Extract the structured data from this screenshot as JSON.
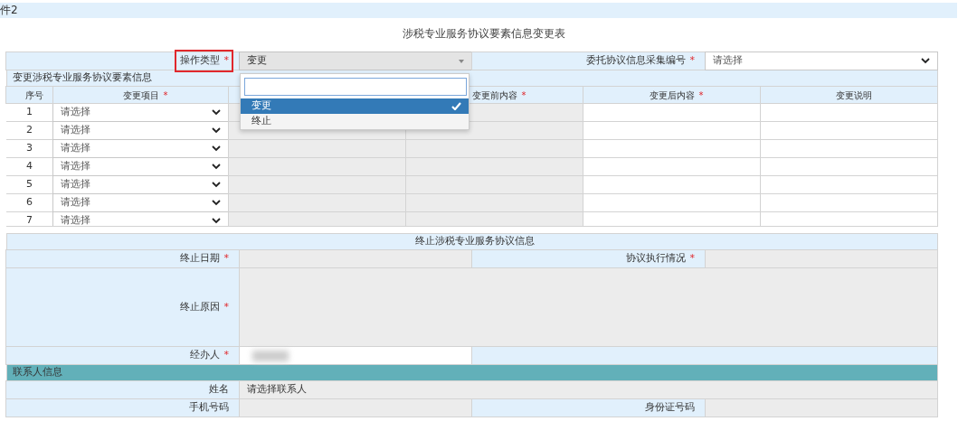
{
  "header": {
    "title": "件2"
  },
  "form_title": "涉税专业服务协议要素信息变更表",
  "top_fields": [
    {
      "label": "操作类型",
      "required_mark": "*",
      "highlighted": true,
      "kind": "combo",
      "value": "变更"
    },
    {
      "label": "委托协议信息采集编号",
      "required_mark": "*",
      "highlighted": false,
      "kind": "select",
      "value": "请选择"
    }
  ],
  "dropdown": {
    "options": [
      {
        "label": "变更",
        "selected": true
      },
      {
        "label": "终止",
        "selected": false
      }
    ]
  },
  "change_section": {
    "title": "变更涉税专业服务协议要素信息",
    "columns": [
      {
        "label": "序号"
      },
      {
        "label": "变更项目",
        "required_mark": "*"
      },
      {
        "kind": "covered"
      },
      {
        "label": "变更前内容",
        "required_mark": "*"
      },
      {
        "label": "变更后内容",
        "required_mark": "*"
      },
      {
        "label": "变更说明"
      }
    ],
    "rows": [
      {
        "number": "1",
        "item": "请选择"
      },
      {
        "number": "2",
        "item": "请选择"
      },
      {
        "number": "3",
        "item": "请选择"
      },
      {
        "number": "4",
        "item": "请选择"
      },
      {
        "number": "5",
        "item": "请选择"
      },
      {
        "number": "6",
        "item": "请选择"
      },
      {
        "number": "7",
        "item": "请选择"
      }
    ]
  },
  "termination": {
    "title": "终止涉税专业服务协议信息",
    "date": {
      "label": "终止日期",
      "required_mark": "*"
    },
    "execution": {
      "label": "协议执行情况",
      "required_mark": "*"
    },
    "reason": {
      "label": "终止原因",
      "required_mark": "*"
    },
    "handler": {
      "label": "经办人",
      "required_mark": "*"
    }
  },
  "contact": {
    "title": "联系人信息",
    "name": {
      "label": "姓名",
      "value": "请选择联系人"
    },
    "phone": {
      "label": "手机号码"
    },
    "id_number": {
      "label": "身份证号码"
    }
  }
}
